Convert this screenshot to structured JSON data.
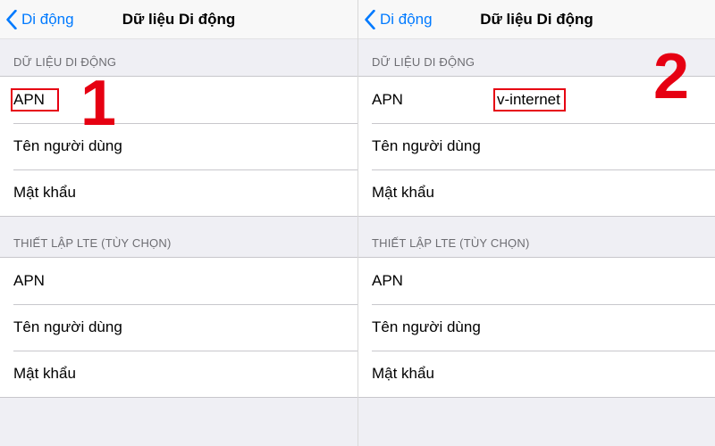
{
  "panes": [
    {
      "back_label": "Di động",
      "title": "Dữ liệu Di động",
      "step_number": "1",
      "groups": [
        {
          "header": "DỮ LIỆU DI ĐỘNG",
          "rows": [
            {
              "label": "APN",
              "value": ""
            },
            {
              "label": "Tên người dùng",
              "value": ""
            },
            {
              "label": "Mật khẩu",
              "value": ""
            }
          ]
        },
        {
          "header": "THIẾT LẬP LTE (TÙY CHỌN)",
          "rows": [
            {
              "label": "APN",
              "value": ""
            },
            {
              "label": "Tên người dùng",
              "value": ""
            },
            {
              "label": "Mật khẩu",
              "value": ""
            }
          ]
        }
      ],
      "highlight": {
        "target": "apn-label"
      }
    },
    {
      "back_label": "Di động",
      "title": "Dữ liệu Di động",
      "step_number": "2",
      "groups": [
        {
          "header": "DỮ LIỆU DI ĐỘNG",
          "rows": [
            {
              "label": "APN",
              "value": "v-internet"
            },
            {
              "label": "Tên người dùng",
              "value": ""
            },
            {
              "label": "Mật khẩu",
              "value": ""
            }
          ]
        },
        {
          "header": "THIẾT LẬP LTE (TÙY CHỌN)",
          "rows": [
            {
              "label": "APN",
              "value": ""
            },
            {
              "label": "Tên người dùng",
              "value": ""
            },
            {
              "label": "Mật khẩu",
              "value": ""
            }
          ]
        }
      ],
      "highlight": {
        "target": "apn-value"
      }
    }
  ],
  "colors": {
    "accent": "#007aff",
    "annotation": "#e60012"
  }
}
